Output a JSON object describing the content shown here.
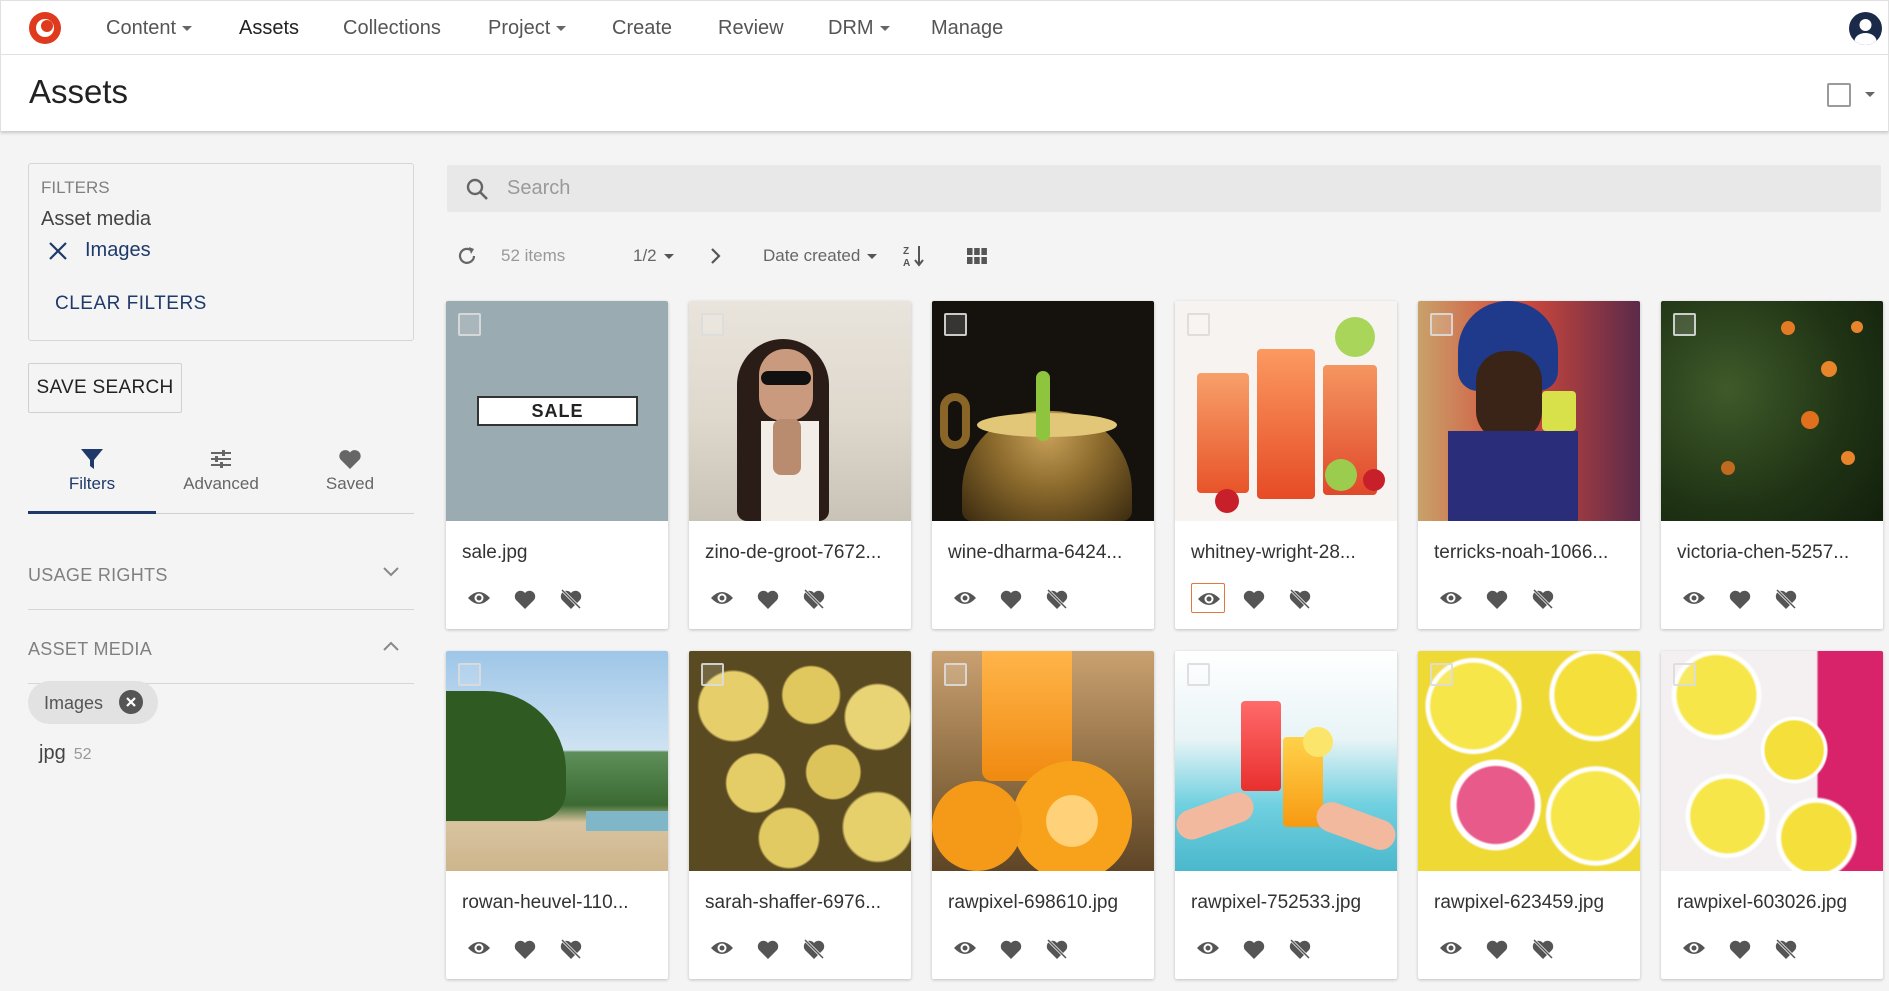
{
  "nav": {
    "items": [
      {
        "label": "Content",
        "caret": true
      },
      {
        "label": "Assets",
        "caret": false,
        "active": true
      },
      {
        "label": "Collections",
        "caret": false
      },
      {
        "label": "Project",
        "caret": true
      },
      {
        "label": "Create",
        "caret": false
      },
      {
        "label": "Review",
        "caret": false
      },
      {
        "label": "DRM",
        "caret": true
      },
      {
        "label": "Manage",
        "caret": false
      }
    ],
    "logo_icon": "brand-logo-icon",
    "avatar_icon": "user-avatar-icon",
    "accent": "#e03a1e"
  },
  "page": {
    "title": "Assets"
  },
  "filters": {
    "title": "FILTERS",
    "group": "Asset media",
    "active_value": "Images",
    "clear_label": "CLEAR FILTERS"
  },
  "save_search_label": "SAVE SEARCH",
  "tabs": [
    {
      "label": "Filters",
      "icon": "funnel-icon",
      "active": true
    },
    {
      "label": "Advanced",
      "icon": "sliders-icon"
    },
    {
      "label": "Saved",
      "icon": "heart-icon"
    }
  ],
  "accordions": {
    "usage_rights": "USAGE RIGHTS",
    "asset_media": "ASSET MEDIA"
  },
  "chip": {
    "label": "Images"
  },
  "facet": {
    "label": "jpg",
    "count": "52"
  },
  "search": {
    "placeholder": "Search",
    "value": ""
  },
  "toolbar": {
    "count": "52 items",
    "page": "1/2",
    "sort": "Date created",
    "icons": [
      "refresh-icon",
      "chevron-right-icon",
      "sort-az-icon",
      "grid-view-icon"
    ]
  },
  "assets": [
    {
      "name": "sale.jpg"
    },
    {
      "name": "zino-de-groot-7672..."
    },
    {
      "name": "wine-dharma-6424..."
    },
    {
      "name": "whitney-wright-28..."
    },
    {
      "name": "terricks-noah-1066..."
    },
    {
      "name": "victoria-chen-5257..."
    },
    {
      "name": "rowan-heuvel-110..."
    },
    {
      "name": "sarah-shaffer-6976..."
    },
    {
      "name": "rawpixel-698610.jpg"
    },
    {
      "name": "rawpixel-752533.jpg"
    },
    {
      "name": "rawpixel-623459.jpg"
    },
    {
      "name": "rawpixel-603026.jpg"
    }
  ],
  "sale_banner_text": "SALE"
}
